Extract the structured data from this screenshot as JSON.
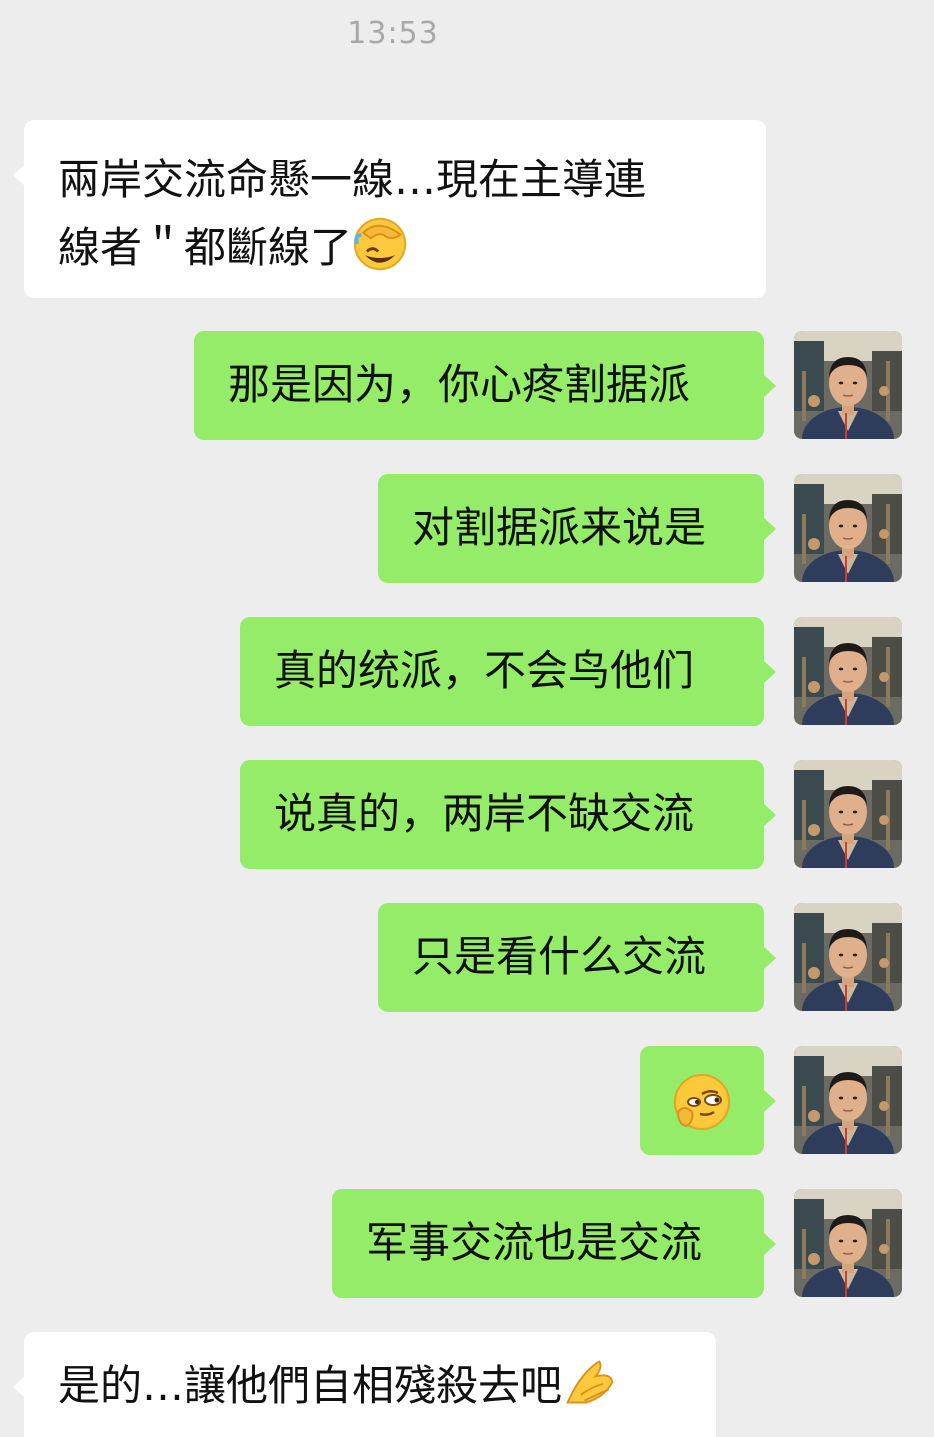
{
  "timestamp": "13:53",
  "messages": [
    {
      "side": "in",
      "lines": [
        "兩岸交流命懸一線…現在主導連",
        "線者＂都斷線了"
      ],
      "trailing_emoji": "facepalm-emoji"
    },
    {
      "side": "out",
      "text": "那是因为，你心疼割据派"
    },
    {
      "side": "out",
      "text": "对割据派来说是"
    },
    {
      "side": "out",
      "text": "真的统派，不会鸟他们"
    },
    {
      "side": "out",
      "text": "说真的，两岸不缺交流"
    },
    {
      "side": "out",
      "text": "只是看什么交流"
    },
    {
      "side": "out",
      "emoji": "smirk-thinking-emoji"
    },
    {
      "side": "out",
      "text": "军事交流也是交流"
    },
    {
      "side": "in",
      "text": "是的…讓他們自相殘殺去吧",
      "trailing_emoji": "bowing-hands-emoji"
    }
  ],
  "colors": {
    "background": "#ededed",
    "incoming_bubble": "#ffffff",
    "outgoing_bubble": "#95ec69",
    "timestamp": "#a8a8a8"
  }
}
